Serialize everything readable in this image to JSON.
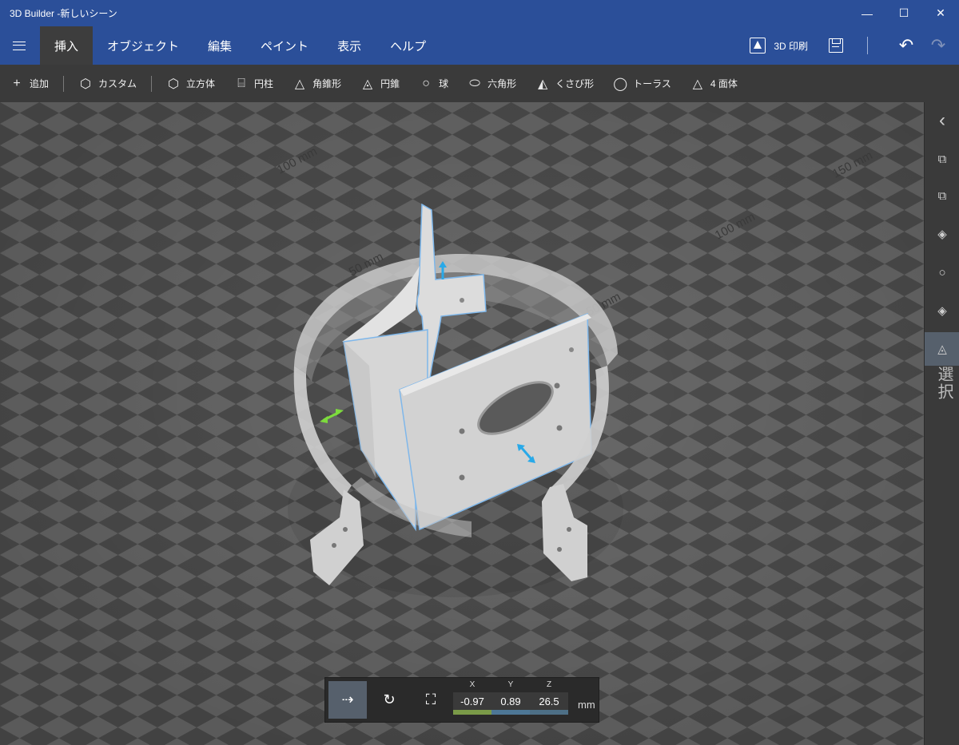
{
  "window": {
    "title": "3D Builder -新しいシーン",
    "controls": {
      "minimize": "—",
      "maximize": "☐",
      "close": "✕"
    }
  },
  "menu": {
    "tabs": [
      {
        "label": "挿入",
        "active": true
      },
      {
        "label": "オブジェクト"
      },
      {
        "label": "編集"
      },
      {
        "label": "ペイント"
      },
      {
        "label": "表示"
      },
      {
        "label": "ヘルプ"
      }
    ],
    "print_label": "3D 印刷",
    "undo_glyph": "↶",
    "redo_glyph": "↷"
  },
  "toolbar": {
    "add": {
      "label": "追加",
      "icon": "plus-icon",
      "glyph": "+"
    },
    "custom": {
      "label": "カスタム",
      "icon": "custom-shapes-icon",
      "glyph": "⬡"
    },
    "shapes": [
      {
        "label": "立方体",
        "icon": "cube-icon",
        "glyph": "⬡"
      },
      {
        "label": "円柱",
        "icon": "cylinder-icon",
        "glyph": "⌸"
      },
      {
        "label": "角錐形",
        "icon": "pyramid-icon",
        "glyph": "△"
      },
      {
        "label": "円錐",
        "icon": "cone-icon",
        "glyph": "◬"
      },
      {
        "label": "球",
        "icon": "sphere-icon",
        "glyph": "○"
      },
      {
        "label": "六角形",
        "icon": "hexagon-icon",
        "glyph": "⬭"
      },
      {
        "label": "くさび形",
        "icon": "wedge-icon",
        "glyph": "◭"
      },
      {
        "label": "トーラス",
        "icon": "torus-icon",
        "glyph": "◯"
      },
      {
        "label": "4 面体",
        "icon": "tetrahedron-icon",
        "glyph": "△"
      }
    ]
  },
  "viewport": {
    "grid_labels": [
      "100 mm",
      "150 mm",
      "100 mm",
      "50 mm",
      "50 mm"
    ],
    "colors": {
      "checker_light": "#6a6a6a",
      "checker_dark": "#4e4e4e",
      "model": "#d9d9d9",
      "selection": "#7fb7ea",
      "gizmo_blue": "#29a9e8",
      "gizmo_green": "#7ddb3d"
    }
  },
  "right_panel": {
    "collapse_glyph": "‹",
    "items": [
      "⧉",
      "⧉",
      "◈",
      "○",
      "◈",
      "◬"
    ],
    "mode_label": "選択"
  },
  "transform": {
    "coords": [
      {
        "axis": "X",
        "value": "-0.97"
      },
      {
        "axis": "Y",
        "value": "0.89"
      },
      {
        "axis": "Z",
        "value": "26.5"
      }
    ],
    "unit": "mm"
  }
}
